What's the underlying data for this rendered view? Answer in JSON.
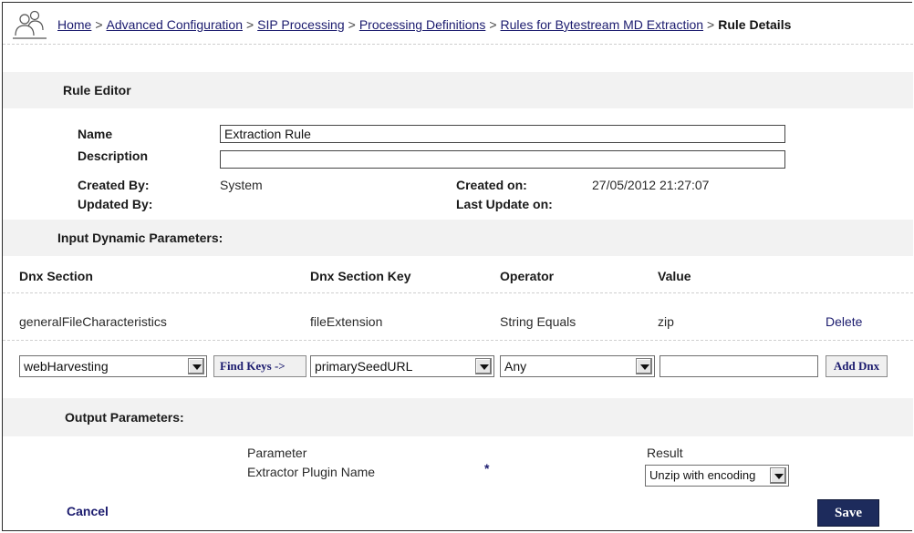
{
  "breadcrumb": {
    "items": [
      "Home",
      "Advanced Configuration",
      "SIP Processing",
      "Processing Definitions",
      "Rules for Bytestream MD Extraction"
    ],
    "current": "Rule Details",
    "separator": ">"
  },
  "rule_editor": {
    "title": "Rule Editor",
    "name_label": "Name",
    "name_value": "Extraction Rule",
    "description_label": "Description",
    "description_value": "",
    "created_by_label": "Created By:",
    "created_by_value": "System",
    "updated_by_label": "Updated By:",
    "updated_by_value": "",
    "created_on_label": "Created on:",
    "created_on_value": "27/05/2012 21:27:07",
    "last_update_label": "Last Update on:",
    "last_update_value": ""
  },
  "input_params": {
    "title": "Input Dynamic Parameters:",
    "columns": [
      "Dnx Section",
      "Dnx Section Key",
      "Operator",
      "Value"
    ],
    "rows": [
      {
        "section": "generalFileCharacteristics",
        "key": "fileExtension",
        "operator": "String Equals",
        "value": "zip",
        "action": "Delete"
      }
    ],
    "new_row": {
      "section_selected": "webHarvesting",
      "find_keys_label": "Find Keys ->",
      "key_selected": "primarySeedURL",
      "operator_selected": "Any",
      "value": "",
      "add_label": "Add Dnx"
    }
  },
  "output_params": {
    "title": "Output Parameters:",
    "parameter_header": "Parameter",
    "result_header": "Result",
    "row_label": "Extractor Plugin Name",
    "required_marker": "*",
    "result_selected": "Unzip with encoding"
  },
  "actions": {
    "cancel_label": "Cancel",
    "save_label": "Save"
  },
  "colors": {
    "link": "#1b1b6e",
    "section_bg": "#f2f2f2",
    "save_bg": "#1d2b5c"
  }
}
